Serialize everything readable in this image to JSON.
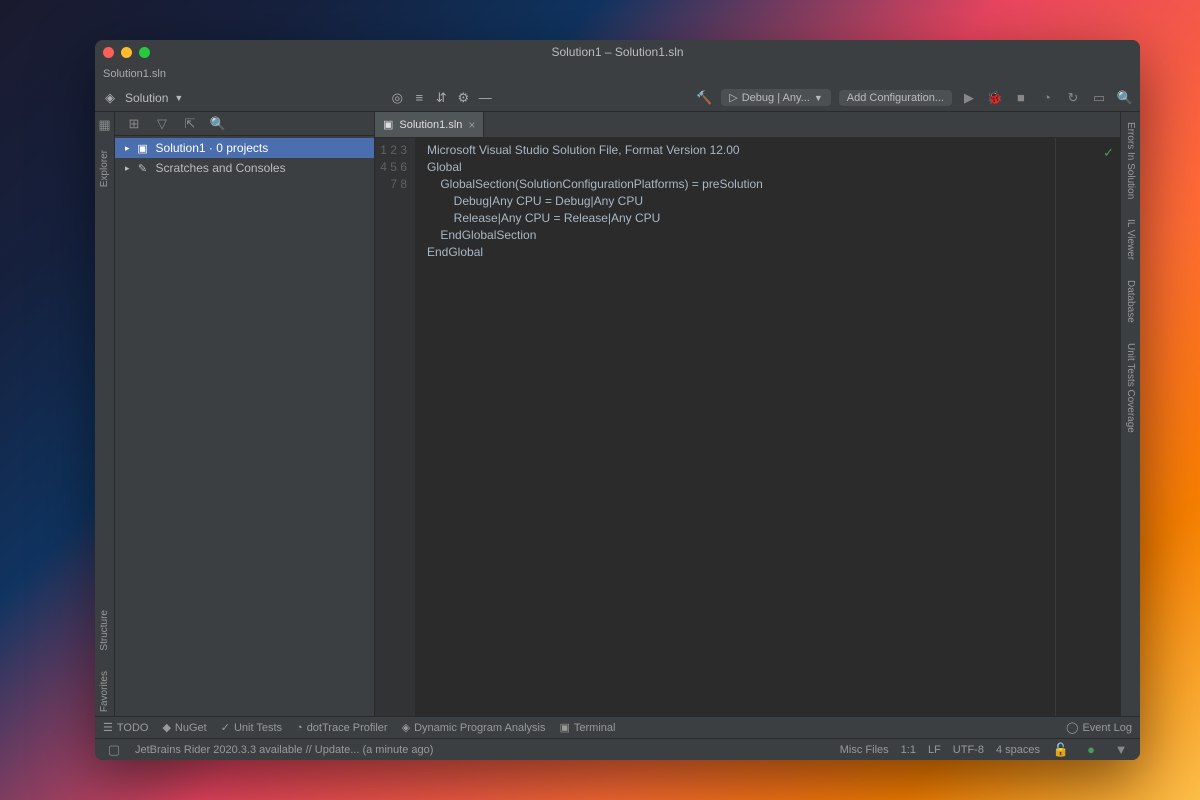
{
  "window": {
    "title": "Solution1 – Solution1.sln"
  },
  "tabstrip": {
    "filename": "Solution1.sln"
  },
  "toolbar": {
    "solution_label": "Solution",
    "run_config": "Debug | Any...",
    "add_config": "Add Configuration..."
  },
  "explorer": {
    "tab_label": "Explorer",
    "items": [
      {
        "label": "Solution1 · 0 projects",
        "selected": true,
        "icon": "solution"
      },
      {
        "label": "Scratches and Consoles",
        "selected": false,
        "icon": "scratch"
      }
    ]
  },
  "editor": {
    "tab": {
      "label": "Solution1.sln"
    },
    "lines": [
      "Microsoft Visual Studio Solution File, Format Version 12.00",
      "Global",
      "    GlobalSection(SolutionConfigurationPlatforms) = preSolution",
      "        Debug|Any CPU = Debug|Any CPU",
      "        Release|Any CPU = Release|Any CPU",
      "    EndGlobalSection",
      "EndGlobal",
      ""
    ]
  },
  "left_gutter": [
    "Explorer"
  ],
  "left_gutter_bottom": [
    "Structure",
    "Favorites"
  ],
  "right_gutter": [
    "Errors In Solution",
    "IL Viewer",
    "Database",
    "Unit Tests Coverage"
  ],
  "bottom": {
    "items": [
      "TODO",
      "NuGet",
      "Unit Tests",
      "dotTrace Profiler",
      "Dynamic Program Analysis",
      "Terminal"
    ],
    "event_log": "Event Log"
  },
  "status": {
    "left": "JetBrains Rider 2020.3.3 available // Update... (a minute ago)",
    "misc": "Misc Files",
    "pos": "1:1",
    "lf": "LF",
    "enc": "UTF-8",
    "indent": "4 spaces"
  }
}
